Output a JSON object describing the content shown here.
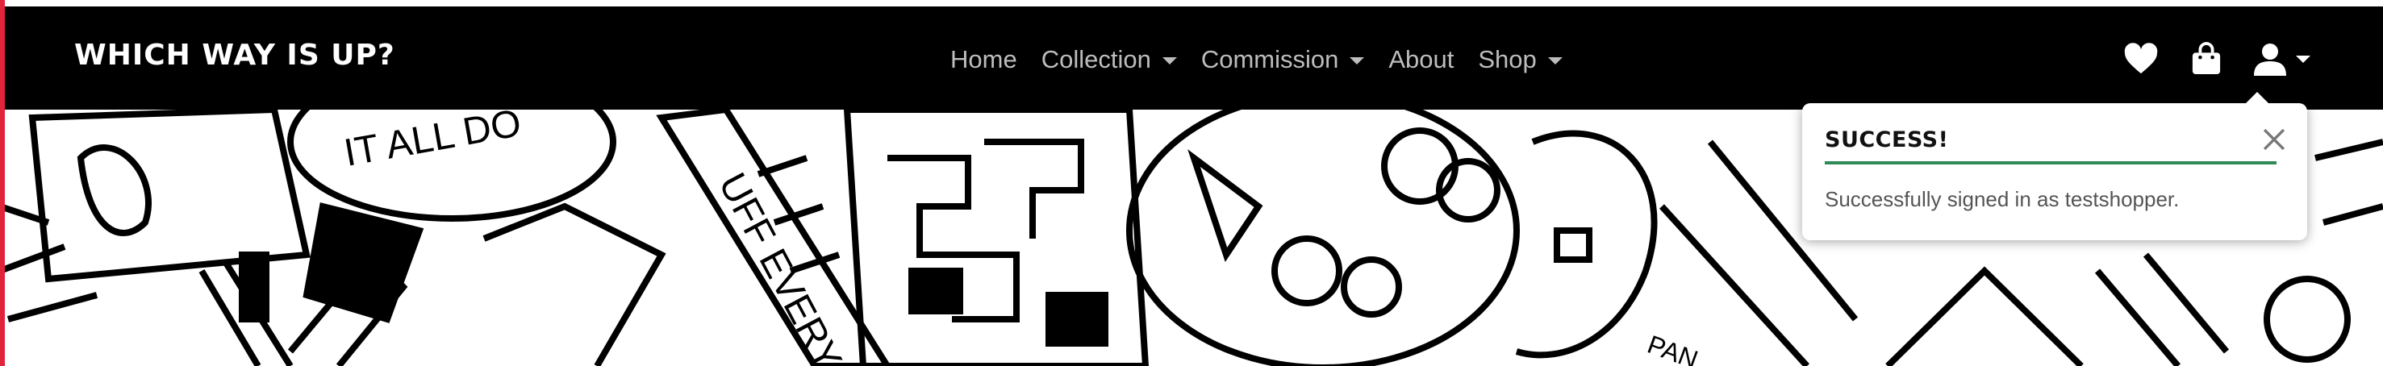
{
  "brand": {
    "title": "WHICH WAY IS UP?"
  },
  "nav": {
    "items": [
      {
        "label": "Home",
        "dropdown": false
      },
      {
        "label": "Collection",
        "dropdown": true
      },
      {
        "label": "Commission",
        "dropdown": true
      },
      {
        "label": "About",
        "dropdown": false
      },
      {
        "label": "Shop",
        "dropdown": true
      }
    ]
  },
  "icons": {
    "wishlist": "heart-icon",
    "bag": "shopping-bag-icon",
    "account": "user-icon"
  },
  "toast": {
    "title": "SUCCESS!",
    "message": "Successfully signed in as testshopper.",
    "accent": "#2e8b57"
  },
  "colors": {
    "navbar": "#000000",
    "accent_edge": "#e0243c"
  }
}
